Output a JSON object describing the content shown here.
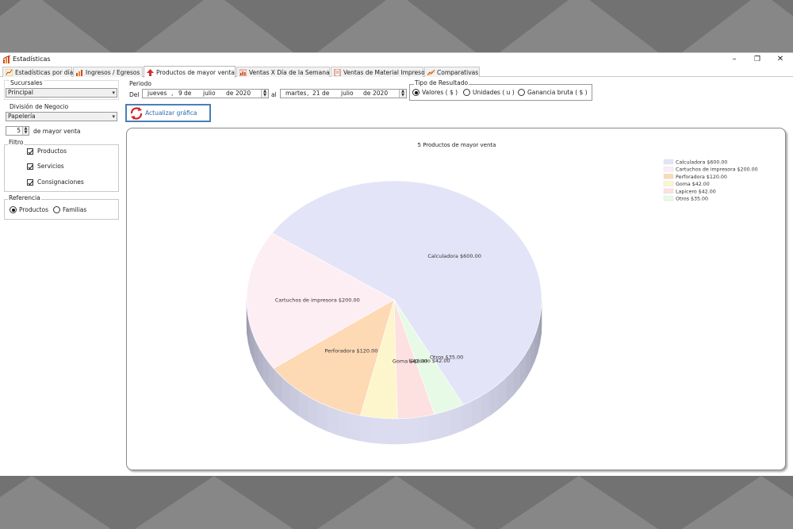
{
  "window": {
    "title": "Estadísticas",
    "controls": {
      "minimize": "–",
      "maximize": "❐",
      "close": "✕"
    }
  },
  "tabs": [
    {
      "label": "Estadísticas por día",
      "icon": "line-chart-icon",
      "active": false
    },
    {
      "label": "Ingresos / Egresos",
      "icon": "bar-chart-icon",
      "active": false
    },
    {
      "label": "Productos de mayor venta",
      "icon": "trend-up-icon",
      "active": true
    },
    {
      "label": "Ventas X Día de la Semana",
      "icon": "calendar-chart-icon",
      "active": false
    },
    {
      "label": "Ventas de Material Impreso",
      "icon": "document-chart-icon",
      "active": false
    },
    {
      "label": "Comparativas",
      "icon": "comparison-chart-icon",
      "active": false
    }
  ],
  "filters": {
    "sucursales_label": "Sucursales",
    "sucursales_value": "Principal",
    "division_label": "División de Negocio",
    "division_value": "Papelería",
    "top_count": "5",
    "top_count_label": "de mayor venta",
    "filtro_label": "Filtro",
    "filtro_items": [
      "Productos",
      "Servicios",
      "Consignaciones"
    ],
    "referencia_label": "Referencia",
    "referencia_options": [
      "Productos",
      "Familias"
    ],
    "referencia_selected": "Productos"
  },
  "periodo": {
    "label": "Periodo",
    "del_label": "Del",
    "from": {
      "weekday": "jueves",
      "sep1": ",",
      "day": "9",
      "de1": "de",
      "month": "julio",
      "de2": "de",
      "year": "2020"
    },
    "al_label": "al",
    "to": {
      "weekday": "martes",
      "sep1": ",",
      "day": "21",
      "de1": "de",
      "month": "julio",
      "de2": "de",
      "year": "2020"
    }
  },
  "tipo_resultado": {
    "label": "Tipo de Resultado",
    "options": [
      "Valores ( $ )",
      "Unidades ( u )",
      "Ganancia bruta ( $ )"
    ],
    "selected": "Valores ( $ )"
  },
  "update_button": "Actualizar gráfica",
  "chart_data": {
    "type": "pie",
    "title": "5 Productos de mayor venta",
    "categories": [
      "Calculadora",
      "Cartuchos de impresora",
      "Perforadora",
      "Goma",
      "Lapicero",
      "Otros"
    ],
    "values": [
      600,
      200,
      120,
      42,
      42,
      35
    ],
    "slice_labels": [
      "Calculadora $600.00",
      "Cartuchos de impresora $200.00",
      "Perforadora $120.00",
      "Goma $42.00",
      "Lapicero $42.00",
      "Otros $35.00"
    ],
    "legend_entries": [
      "Calculadora $600.00",
      "Cartuchos de impresora $200.00",
      "Perforadora $120.00",
      "Goma $42.00",
      "Lapicero $42.00",
      "Otros $35.00"
    ],
    "legend_position": "top-right",
    "colors": [
      "#e4e4f8",
      "#fdeef3",
      "#fdd9b4",
      "#fdf6cc",
      "#fde0e0",
      "#e6fae6"
    ],
    "style": "3d"
  }
}
